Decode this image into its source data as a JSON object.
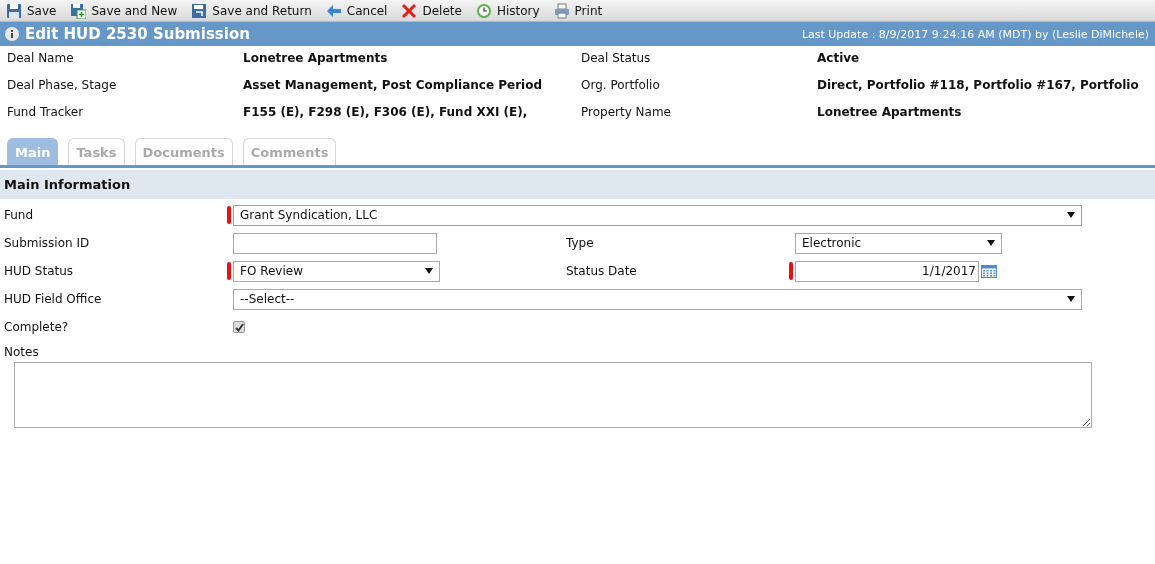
{
  "toolbar": [
    {
      "kind": "save",
      "label": "Save"
    },
    {
      "kind": "save_new",
      "label": "Save and New"
    },
    {
      "kind": "save_return",
      "label": "Save and Return"
    },
    {
      "kind": "cancel",
      "label": "Cancel"
    },
    {
      "kind": "delete",
      "label": "Delete"
    },
    {
      "kind": "history",
      "label": "History"
    },
    {
      "kind": "print",
      "label": "Print"
    }
  ],
  "header": {
    "title": "Edit HUD 2530 Submission",
    "last_update": "Last Update : 8/9/2017 9:24:16 AM (MDT) by (Leslie DiMichele)"
  },
  "summary": [
    {
      "label": "Deal Name",
      "value": "Lonetree Apartments"
    },
    {
      "label": "Deal Status",
      "value": "Active"
    },
    {
      "label": "Deal Phase, Stage",
      "value": "Asset Management, Post Compliance Period"
    },
    {
      "label": "Org. Portfolio",
      "value": "Direct, Portfolio #118, Portfolio #167, Portfolio"
    },
    {
      "label": "Fund Tracker",
      "value": "F155 (E), F298 (E), F306 (E), Fund XXI (E),"
    },
    {
      "label": "Property Name",
      "value": "Lonetree Apartments"
    }
  ],
  "tabs": [
    {
      "label": "Main",
      "selected": true
    },
    {
      "label": "Tasks",
      "selected": false
    },
    {
      "label": "Documents",
      "selected": false
    },
    {
      "label": "Comments",
      "selected": false
    }
  ],
  "section": {
    "title": "Main Information",
    "rows": [
      {
        "fields": [
          {
            "kind": "select",
            "label": "Fund",
            "value": "Grant Syndication, LLC",
            "required": true,
            "wide": true
          }
        ]
      },
      {
        "fields": [
          {
            "kind": "text",
            "label": "Submission ID",
            "required": false
          },
          {
            "kind": "select",
            "label": "Type",
            "value": "Electronic",
            "required": false
          }
        ]
      },
      {
        "fields": [
          {
            "kind": "select",
            "label": "HUD Status",
            "value": "FO Review",
            "required": true
          },
          {
            "kind": "date",
            "label": "Status Date",
            "value": "1/1/2017",
            "required": true
          }
        ]
      },
      {
        "fields": [
          {
            "kind": "select",
            "label": "HUD Field Office",
            "value": "--Select--",
            "required": false,
            "wide": true
          }
        ]
      },
      {
        "fields": [
          {
            "kind": "checkbox",
            "label": "Complete?",
            "checked": true
          }
        ]
      }
    ],
    "notes_label": "Notes"
  }
}
